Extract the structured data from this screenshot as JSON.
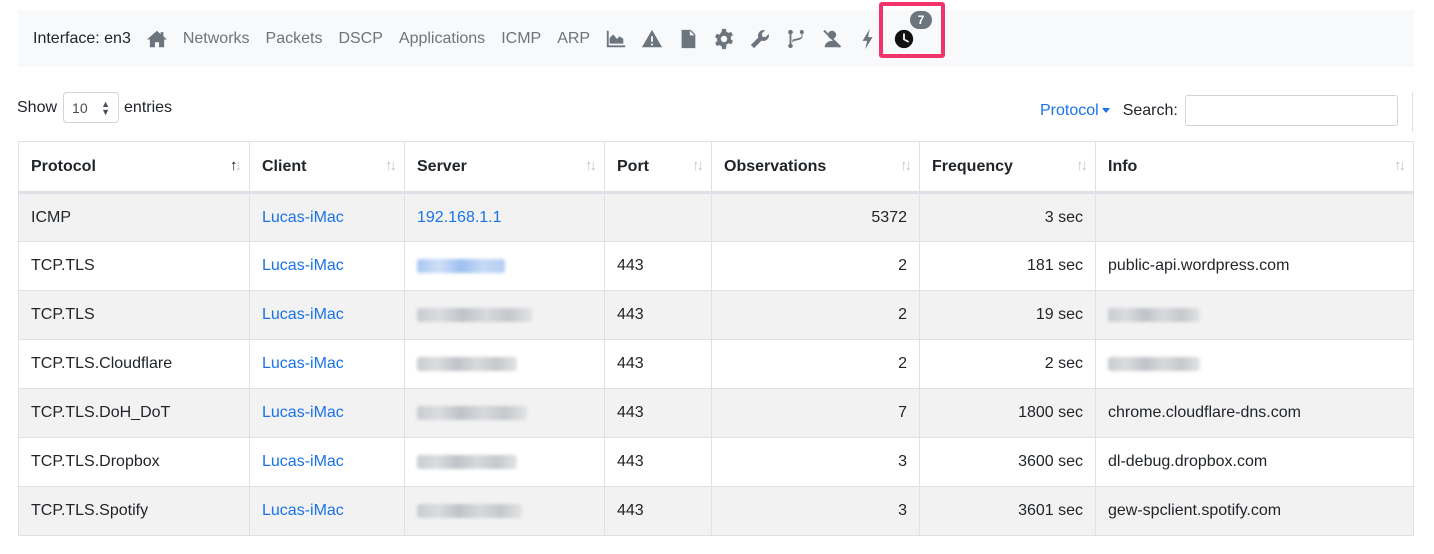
{
  "navbar": {
    "interface_label": "Interface: en3",
    "links": [
      "Networks",
      "Packets",
      "DSCP",
      "Applications",
      "ICMP",
      "ARP"
    ],
    "icons": [
      "home-icon",
      "chart-area-icon",
      "warning-icon",
      "document-icon",
      "gear-icon",
      "wrench-icon",
      "branch-icon",
      "user-slash-icon",
      "bolt-icon",
      "clock-icon"
    ],
    "badge_count": "7"
  },
  "controls": {
    "show_label": "Show",
    "page_length": "10",
    "entries_label": "entries",
    "protocol_filter": "Protocol",
    "search_label": "Search:",
    "search_value": ""
  },
  "table": {
    "columns": [
      "Protocol",
      "Client",
      "Server",
      "Port",
      "Observations",
      "Frequency",
      "Info"
    ],
    "rows": [
      {
        "protocol": "ICMP",
        "client": "Lucas-iMac",
        "server": "192.168.1.1",
        "port": "",
        "observations": "5372",
        "frequency": "3 sec",
        "info": ""
      },
      {
        "protocol": "TCP.TLS",
        "client": "Lucas-iMac",
        "server": "",
        "port": "443",
        "observations": "2",
        "frequency": "181 sec",
        "info": "public-api.wordpress.com"
      },
      {
        "protocol": "TCP.TLS",
        "client": "Lucas-iMac",
        "server": "",
        "port": "443",
        "observations": "2",
        "frequency": "19 sec",
        "info": ""
      },
      {
        "protocol": "TCP.TLS.Cloudflare",
        "client": "Lucas-iMac",
        "server": "",
        "port": "443",
        "observations": "2",
        "frequency": "2 sec",
        "info": ""
      },
      {
        "protocol": "TCP.TLS.DoH_DoT",
        "client": "Lucas-iMac",
        "server": "",
        "port": "443",
        "observations": "7",
        "frequency": "1800 sec",
        "info": "chrome.cloudflare-dns.com"
      },
      {
        "protocol": "TCP.TLS.Dropbox",
        "client": "Lucas-iMac",
        "server": "",
        "port": "443",
        "observations": "3",
        "frequency": "3600 sec",
        "info": "dl-debug.dropbox.com"
      },
      {
        "protocol": "TCP.TLS.Spotify",
        "client": "Lucas-iMac",
        "server": "",
        "port": "443",
        "observations": "3",
        "frequency": "3601 sec",
        "info": "gew-spclient.spotify.com"
      }
    ]
  }
}
